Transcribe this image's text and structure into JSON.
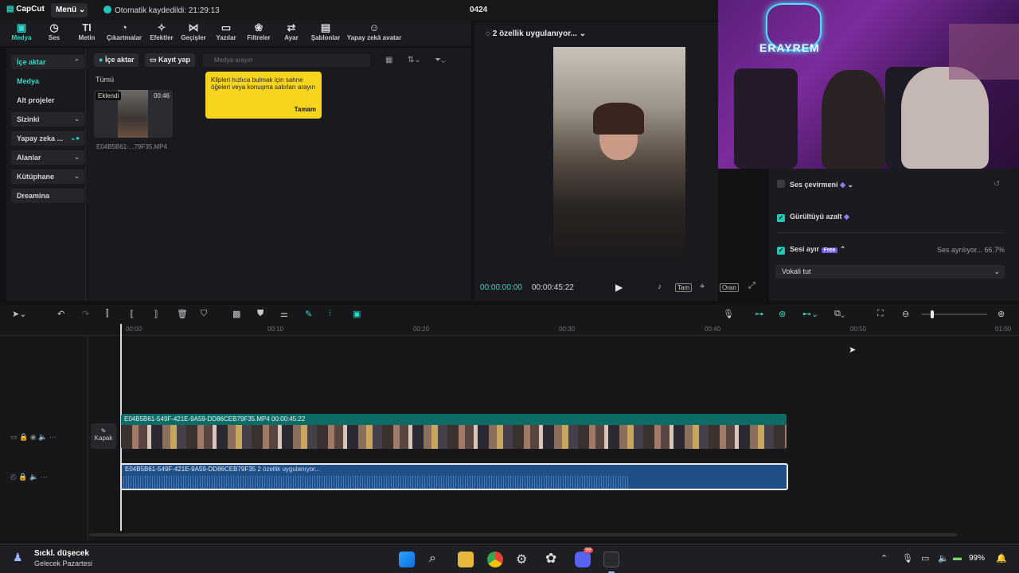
{
  "titlebar": {
    "app_name": "CapCut",
    "menu_label": "Menü",
    "autosave_text": "Otomatik kaydedildi: 21:29:13",
    "project_title": "0424"
  },
  "tools": [
    {
      "label": "Medya",
      "icon": "media-icon"
    },
    {
      "label": "Ses",
      "icon": "audio-icon"
    },
    {
      "label": "Metin",
      "icon": "text-icon"
    },
    {
      "label": "Çıkartmalar",
      "icon": "sticker-icon"
    },
    {
      "label": "Efektler",
      "icon": "effects-icon"
    },
    {
      "label": "Geçişler",
      "icon": "transitions-icon"
    },
    {
      "label": "Yazılar",
      "icon": "captions-icon"
    },
    {
      "label": "Filtreler",
      "icon": "filters-icon"
    },
    {
      "label": "Ayar",
      "icon": "adjust-icon"
    },
    {
      "label": "Şablonlar",
      "icon": "templates-icon"
    },
    {
      "label": "Yapay zekâ avatar",
      "icon": "ai-avatar-icon"
    }
  ],
  "leftnav": [
    {
      "label": "İçe aktar"
    },
    {
      "label": "Medya"
    },
    {
      "label": "Alt projeler"
    },
    {
      "label": "Sizinki"
    },
    {
      "label": "Yapay zeka ..."
    },
    {
      "label": "Alanlar"
    },
    {
      "label": "Kütüphane"
    },
    {
      "label": "Dreamina"
    }
  ],
  "media": {
    "import_btn": "İçe aktar",
    "record_btn": "Kayıt yap",
    "search_placeholder": "Medya arayın",
    "filter_all": "Tümü",
    "tooltip_text": "Klipleri hızlıca bulmak için sahne öğeleri veya konuşma satırları arayın",
    "tooltip_ok": "Tamam",
    "clip_badge": "Eklendi",
    "clip_duration": "00:46",
    "clip_name": "E04B5B61-...79F35.MP4"
  },
  "preview": {
    "status": "2 özellik uygulanıyor...",
    "time_current": "00:00:00:00",
    "time_total": "00:00:45:22",
    "full_label": "Tam",
    "ratio_label": "Oran"
  },
  "rightpanel": {
    "voice_translate": "Ses çevirmeni",
    "noise_reduce": "Gürültüyü azalt",
    "separate_voice": "Sesi ayır",
    "free_badge": "Free",
    "separating_status": "Ses ayrılıyor... 66.7%",
    "select_value": "Vokali tut"
  },
  "camera": {
    "logo_text": "ERAYREM"
  },
  "timeline": {
    "ruler": [
      "00:00",
      "00:10",
      "00:20",
      "00:30",
      "00:40",
      "00:50",
      "01:00"
    ],
    "cover_label": "Kapak",
    "video_clip_name": "E04B5B61-549F-421E-9A59-DD86CEB79F35.MP4",
    "video_clip_duration": "00:00:45:22",
    "audio_clip_name": "E04B5B61-549F-421E-9A59-DD86CEB79F35",
    "audio_clip_status": "2 özellik uygulanıyor..."
  },
  "taskbar": {
    "weather_title": "Sıckl. düşecek",
    "weather_sub": "Gelecek Pazartesi",
    "battery": "99%",
    "badge_count": "99"
  },
  "colors": {
    "accent": "#2bd9c9",
    "tooltip": "#f7d51e",
    "video_track": "#0e6b66",
    "audio_track": "#1f4f86"
  }
}
